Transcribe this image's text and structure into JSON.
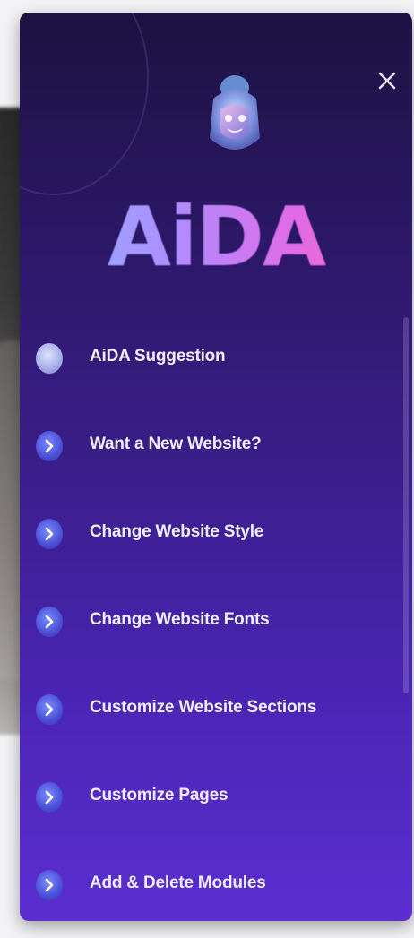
{
  "assistant": {
    "logo_text": "AiDA",
    "close_label": "X",
    "avatar_icon": "robot-avatar-icon"
  },
  "menu": {
    "items": [
      {
        "label": "AiDA Suggestion",
        "icon": "suggestion-dot-icon"
      },
      {
        "label": "Want a New Website?",
        "icon": "chevron-right-icon"
      },
      {
        "label": "Change Website Style",
        "icon": "chevron-right-icon"
      },
      {
        "label": "Change Website Fonts",
        "icon": "chevron-right-icon"
      },
      {
        "label": "Customize Website Sections",
        "icon": "chevron-right-icon"
      },
      {
        "label": "Customize Pages",
        "icon": "chevron-right-icon"
      },
      {
        "label": "Add & Delete Modules",
        "icon": "chevron-right-icon"
      }
    ]
  },
  "colors": {
    "panel_top": "#1c1240",
    "panel_bottom": "#5b2ed1",
    "bullet": "#4a4fd6",
    "text": "#f1eefe"
  }
}
